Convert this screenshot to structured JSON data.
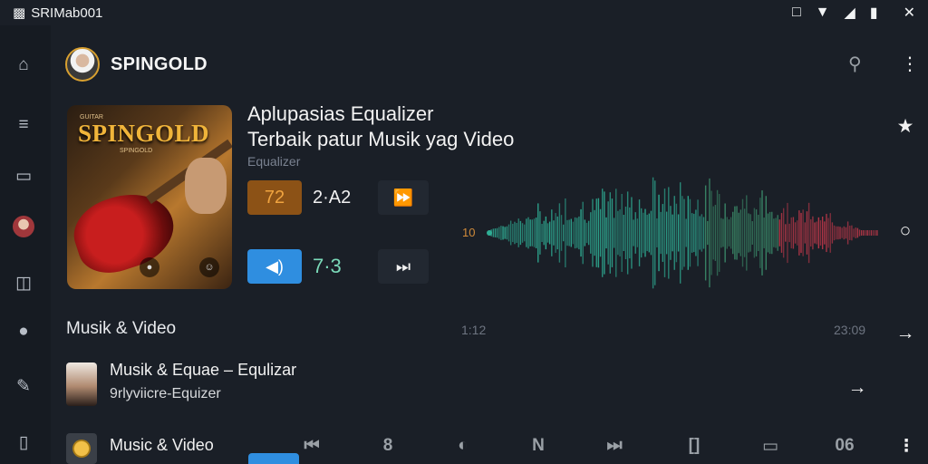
{
  "status_bar": {
    "app_label": "SRIMab001",
    "icons": [
      "app-icon",
      "vibrate-icon",
      "wifi-icon",
      "signal-icon",
      "battery-icon",
      "close-icon"
    ]
  },
  "rail": {
    "icons": [
      "home-icon",
      "equalizer-icon",
      "screen-icon",
      "avatar",
      "library-icon",
      "disc-icon",
      "add-folder-icon",
      "device-icon"
    ]
  },
  "header": {
    "brand": "SPINGOLD",
    "icons": [
      "search-icon",
      "more-vertical-icon"
    ]
  },
  "album_art": {
    "brand_text": "SPINGOLD",
    "caption_top": "GUITAR",
    "caption_sub": "SPINGOLD"
  },
  "now_playing": {
    "title_line1": "Aplupasias Equalizer",
    "title_line2": "Terbaik patur Musik yag Video",
    "subtitle": "Equalizer"
  },
  "controls": {
    "row1": {
      "pill_value": "72",
      "label": "2·A2",
      "button_icon": "skip-forward-icon"
    },
    "row2": {
      "pill_icon": "volume-icon",
      "label": "7·3",
      "button_icon": "next-icon"
    }
  },
  "waveform": {
    "start_label": "10",
    "time_start": "1:12",
    "time_end": "23:09",
    "colors": {
      "teal": "#2fae95",
      "green": "#3b8c6a",
      "red": "#c0384a"
    }
  },
  "right_rail": {
    "icons": [
      "more-vertical-icon",
      "star-icon",
      "circle-icon",
      "arrow-right-icon"
    ]
  },
  "section": {
    "title": "Musik & Video"
  },
  "list": [
    {
      "title": "Musik & Equae – Equlizar",
      "subtitle": "9rlyviicre-Equizer",
      "action_icon": "arrow-right-icon"
    },
    {
      "title": "Music & Video",
      "subtitle": "",
      "action_icon": ""
    }
  ],
  "bottom_bar": {
    "icons": [
      {
        "name": "rewind-icon",
        "glyph": "⏮"
      },
      {
        "name": "eight-icon",
        "glyph": "8"
      },
      {
        "name": "half-circle-icon",
        "glyph": "◐"
      },
      {
        "name": "n-icon",
        "glyph": "N"
      },
      {
        "name": "skip-icon",
        "glyph": "⏭"
      },
      {
        "name": "bracket-icon",
        "glyph": "[]"
      },
      {
        "name": "screen-icon",
        "glyph": "▭"
      },
      {
        "name": "zero-six-icon",
        "glyph": "06"
      },
      {
        "name": "more-vertical-icon",
        "glyph": "⋮"
      }
    ]
  }
}
